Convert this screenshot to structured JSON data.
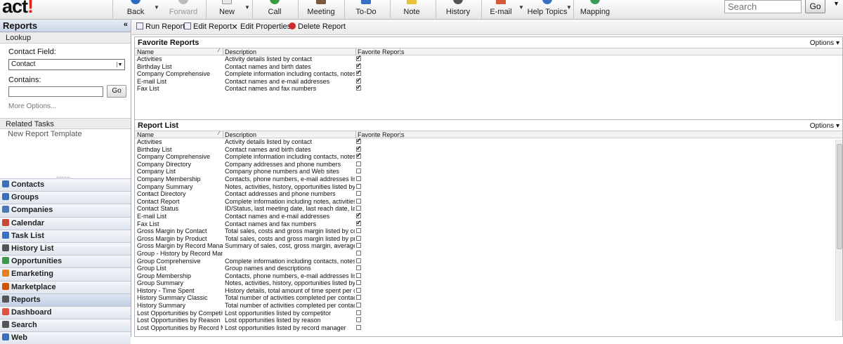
{
  "app": {
    "logo_text": "act",
    "logo_mark": "!"
  },
  "toolbar": {
    "buttons": [
      {
        "label": "Back"
      },
      {
        "label": "Forward"
      },
      {
        "label": "New"
      },
      {
        "label": "Call"
      },
      {
        "label": "Meeting"
      },
      {
        "label": "To-Do"
      },
      {
        "label": "Note"
      },
      {
        "label": "History"
      },
      {
        "label": "E-mail"
      },
      {
        "label": "Help Topics"
      },
      {
        "label": "Mapping"
      }
    ],
    "search_placeholder": "Search",
    "go_label": "Go"
  },
  "sidebar": {
    "title": "Reports",
    "collapse": "«",
    "lookup_title": "Lookup",
    "contact_field_label": "Contact Field:",
    "contact_field_value": "Contact",
    "contains_label": "Contains:",
    "go_label": "Go",
    "more_options": "More Options...",
    "related_tasks_title": "Related Tasks",
    "related_tasks": [
      "New Report Template"
    ],
    "grip": "........",
    "nav": [
      {
        "label": "Contacts",
        "icon": "contacts-icon",
        "color": "#3b6fb6"
      },
      {
        "label": "Groups",
        "icon": "groups-icon",
        "color": "#3b6fb6"
      },
      {
        "label": "Companies",
        "icon": "companies-icon",
        "color": "#4a79b5"
      },
      {
        "label": "Calendar",
        "icon": "calendar-icon",
        "color": "#c9483a"
      },
      {
        "label": "Task List",
        "icon": "task-list-icon",
        "color": "#3a6ec2"
      },
      {
        "label": "History List",
        "icon": "history-icon",
        "color": "#555555"
      },
      {
        "label": "Opportunities",
        "icon": "opportunities-icon",
        "color": "#3a9a4a"
      },
      {
        "label": "Emarketing",
        "icon": "emarketing-icon",
        "color": "#e67e22"
      },
      {
        "label": "Marketplace",
        "icon": "marketplace-icon",
        "color": "#d35400"
      },
      {
        "label": "Reports",
        "icon": "reports-icon",
        "color": "#555555",
        "active": true
      },
      {
        "label": "Dashboard",
        "icon": "dashboard-icon",
        "color": "#e0533f"
      },
      {
        "label": "Search",
        "icon": "search-icon",
        "color": "#555555"
      },
      {
        "label": "Web",
        "icon": "web-icon",
        "color": "#3b6fb6"
      }
    ]
  },
  "actions": [
    {
      "label": "Run Report",
      "icon": "run-report-icon"
    },
    {
      "label": "Edit Report",
      "icon": "edit-report-icon"
    },
    {
      "label": "Edit Properties",
      "icon": "edit-properties-icon"
    },
    {
      "label": "Delete Report",
      "icon": "delete-report-icon"
    }
  ],
  "favorites": {
    "title": "Favorite Reports",
    "options": "Options",
    "columns": [
      "Name",
      "Description",
      "Favorite Reports"
    ],
    "rows": [
      {
        "name": "Activities",
        "desc": "Activity details listed by contact",
        "fav": true
      },
      {
        "name": "Birthday List",
        "desc": "Contact names and birth dates",
        "fav": true
      },
      {
        "name": "Company Comprehensive",
        "desc": "Complete information including contacts, notes, act",
        "fav": true
      },
      {
        "name": "E-mail List",
        "desc": "Contact names and e-mail addresses",
        "fav": true
      },
      {
        "name": "Fax List",
        "desc": "Contact names and fax numbers",
        "fav": true
      }
    ]
  },
  "reports": {
    "title": "Report List",
    "options": "Options",
    "columns": [
      "Name",
      "Description",
      "Favorite Reports"
    ],
    "rows": [
      {
        "name": "Activities",
        "desc": "Activity details listed by contact",
        "fav": true
      },
      {
        "name": "Birthday List",
        "desc": "Contact names and birth dates",
        "fav": true
      },
      {
        "name": "Company Comprehensive",
        "desc": "Complete information including contacts, notes, act",
        "fav": true
      },
      {
        "name": "Company Directory",
        "desc": "Company addresses and phone numbers",
        "fav": false
      },
      {
        "name": "Company List",
        "desc": "Company phone numbers and Web sites",
        "fav": false
      },
      {
        "name": "Company Membership",
        "desc": "Contacts, phone numbers, e-mail addresses listed",
        "fav": false
      },
      {
        "name": "Company Summary",
        "desc": "Notes, activities, history, opportunities listed by cor",
        "fav": false
      },
      {
        "name": "Contact Directory",
        "desc": "Contact addresses and phone numbers",
        "fav": false
      },
      {
        "name": "Contact Report",
        "desc": "Complete information including notes, activities",
        "fav": false
      },
      {
        "name": "Contact Status",
        "desc": "ID/Status, last meeting date, last reach date, last re",
        "fav": false
      },
      {
        "name": "E-mail List",
        "desc": "Contact names and e-mail addresses",
        "fav": true
      },
      {
        "name": "Fax List",
        "desc": "Contact names and fax numbers",
        "fav": true
      },
      {
        "name": "Gross Margin by Contact",
        "desc": "Total sales, costs and gross margin listed by conta",
        "fav": false
      },
      {
        "name": "Gross Margin by Product",
        "desc": "Total sales, costs and gross margin listed by produ",
        "fav": false
      },
      {
        "name": "Gross Margin by Record Manager",
        "desc": "Summary of sales, cost, gross margin, average dis",
        "fav": false
      },
      {
        "name": "Group - History by Record Manager",
        "desc": "",
        "fav": false
      },
      {
        "name": "Group Comprehensive",
        "desc": "Complete information including contacts, notes, act",
        "fav": false
      },
      {
        "name": "Group List",
        "desc": "Group names and descriptions",
        "fav": false
      },
      {
        "name": "Group Membership",
        "desc": "Contacts, phone numbers, e-mail addresses listed",
        "fav": false
      },
      {
        "name": "Group Summary",
        "desc": "Notes, activities, history, opportunities listed by grc",
        "fav": false
      },
      {
        "name": "History - Time Spent",
        "desc": "History details, total amount of time spent per conta",
        "fav": false
      },
      {
        "name": "History Summary Classic",
        "desc": "Total number of activities completed per contact, in",
        "fav": false
      },
      {
        "name": "History Summary",
        "desc": "Total number of activities completed per contact, in",
        "fav": false
      },
      {
        "name": "Lost Opportunities by Competitor",
        "desc": "Lost opportunities listed by competitor",
        "fav": false
      },
      {
        "name": "Lost Opportunities by Reason",
        "desc": "Lost opportunities listed by reason",
        "fav": false
      },
      {
        "name": "Lost Opportunities by Record Manager",
        "desc": "Lost opportunities listed by record manager",
        "fav": false
      }
    ]
  }
}
